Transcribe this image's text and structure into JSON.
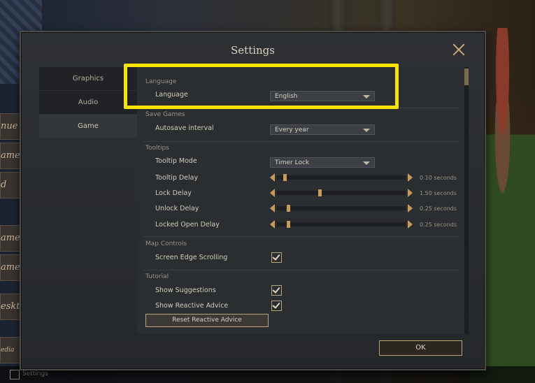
{
  "dialog": {
    "title": "Settings",
    "ok_label": "OK"
  },
  "tabs": [
    {
      "label": "Graphics"
    },
    {
      "label": "Audio"
    },
    {
      "label": "Game"
    }
  ],
  "bg_menu": [
    "nue",
    "ame",
    "d",
    "ame",
    "ame",
    "esktop",
    "edia"
  ],
  "bottom_bar": {
    "label": "Settings"
  },
  "sections": {
    "language": "Language",
    "save_games": "Save Games",
    "tooltips": "Tooltips",
    "map_controls": "Map Controls",
    "tutorial": "Tutorial"
  },
  "language": {
    "label": "Language",
    "value": "English"
  },
  "autosave": {
    "label": "Autosave interval",
    "value": "Every year"
  },
  "tooltip_mode": {
    "label": "Tooltip Mode",
    "value": "Timer Lock"
  },
  "sliders": [
    {
      "label": "Tooltip Delay",
      "value_text": "0.10 seconds",
      "fraction": 0.05
    },
    {
      "label": "Lock Delay",
      "value_text": "1.50 seconds",
      "fraction": 0.33
    },
    {
      "label": "Unlock Delay",
      "value_text": "0.25 seconds",
      "fraction": 0.08
    },
    {
      "label": "Locked Open Delay",
      "value_text": "0.25 seconds",
      "fraction": 0.08
    }
  ],
  "map_controls": {
    "edge_scrolling_label": "Screen Edge Scrolling",
    "edge_scrolling_checked": true
  },
  "tutorial": {
    "suggestions_label": "Show Suggestions",
    "suggestions_checked": true,
    "reactive_label": "Show Reactive Advice",
    "reactive_checked": true,
    "reset_label": "Reset Reactive Advice"
  },
  "colors": {
    "highlight": "#f5e400",
    "accent": "#c89a5a"
  }
}
